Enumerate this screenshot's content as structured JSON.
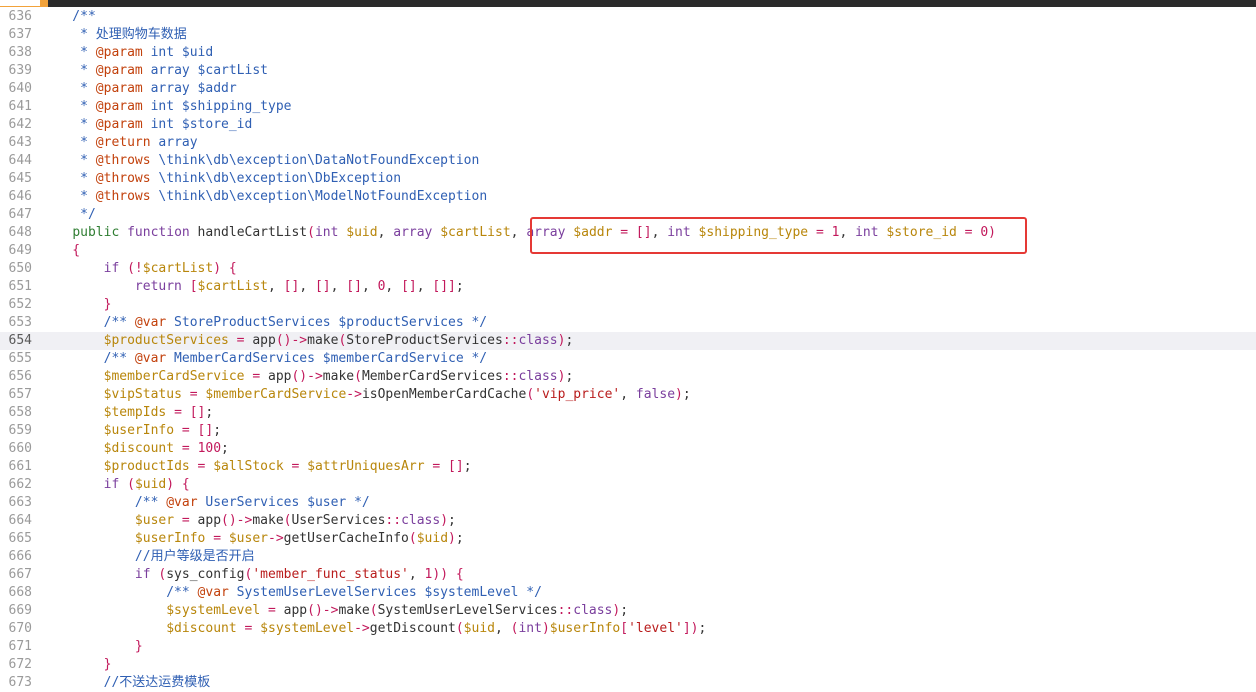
{
  "editor": {
    "active_line": "654",
    "lines": [
      {
        "num": "636",
        "tokens": [
          [
            "cmt",
            "    /**"
          ]
        ]
      },
      {
        "num": "637",
        "tokens": [
          [
            "cmt",
            "     * 处理购物车数据"
          ]
        ]
      },
      {
        "num": "638",
        "tokens": [
          [
            "cmt",
            "     * "
          ],
          [
            "tag",
            "@param"
          ],
          [
            "cmt",
            " int $uid"
          ]
        ]
      },
      {
        "num": "639",
        "tokens": [
          [
            "cmt",
            "     * "
          ],
          [
            "tag",
            "@param"
          ],
          [
            "cmt",
            " array $cartList"
          ]
        ]
      },
      {
        "num": "640",
        "tokens": [
          [
            "cmt",
            "     * "
          ],
          [
            "tag",
            "@param"
          ],
          [
            "cmt",
            " array $addr"
          ]
        ]
      },
      {
        "num": "641",
        "tokens": [
          [
            "cmt",
            "     * "
          ],
          [
            "tag",
            "@param"
          ],
          [
            "cmt",
            " int $shipping_type"
          ]
        ]
      },
      {
        "num": "642",
        "tokens": [
          [
            "cmt",
            "     * "
          ],
          [
            "tag",
            "@param"
          ],
          [
            "cmt",
            " int $store_id"
          ]
        ]
      },
      {
        "num": "643",
        "tokens": [
          [
            "cmt",
            "     * "
          ],
          [
            "tag",
            "@return"
          ],
          [
            "cmt",
            " array"
          ]
        ]
      },
      {
        "num": "644",
        "tokens": [
          [
            "cmt",
            "     * "
          ],
          [
            "tag",
            "@throws"
          ],
          [
            "cmt",
            " \\think\\db\\exception\\DataNotFoundException"
          ]
        ]
      },
      {
        "num": "645",
        "tokens": [
          [
            "cmt",
            "     * "
          ],
          [
            "tag",
            "@throws"
          ],
          [
            "cmt",
            " \\think\\db\\exception\\DbException"
          ]
        ]
      },
      {
        "num": "646",
        "tokens": [
          [
            "cmt",
            "     * "
          ],
          [
            "tag",
            "@throws"
          ],
          [
            "cmt",
            " \\think\\db\\exception\\ModelNotFoundException"
          ]
        ]
      },
      {
        "num": "647",
        "tokens": [
          [
            "cmt",
            "     */"
          ]
        ]
      },
      {
        "num": "648",
        "tokens": [
          [
            "txt",
            "    "
          ],
          [
            "pub",
            "public"
          ],
          [
            "txt",
            " "
          ],
          [
            "kw",
            "function"
          ],
          [
            "fn",
            " handleCartList"
          ],
          [
            "op",
            "("
          ],
          [
            "kw",
            "int"
          ],
          [
            "txt",
            " "
          ],
          [
            "var",
            "$uid"
          ],
          [
            "txt",
            ", "
          ],
          [
            "kw",
            "array"
          ],
          [
            "txt",
            " "
          ],
          [
            "var",
            "$cartList"
          ],
          [
            "txt",
            ", "
          ],
          [
            "kw",
            "array"
          ],
          [
            "txt",
            " "
          ],
          [
            "var",
            "$addr"
          ],
          [
            "op",
            " = []"
          ],
          [
            "txt",
            ", "
          ],
          [
            "kw",
            "int"
          ],
          [
            "txt",
            " "
          ],
          [
            "var",
            "$shipping_type"
          ],
          [
            "op",
            " = "
          ],
          [
            "num",
            "1"
          ],
          [
            "txt",
            ", "
          ],
          [
            "kw",
            "int"
          ],
          [
            "txt",
            " "
          ],
          [
            "var",
            "$store_id"
          ],
          [
            "op",
            " = "
          ],
          [
            "num",
            "0"
          ],
          [
            "op",
            ")"
          ]
        ]
      },
      {
        "num": "649",
        "tokens": [
          [
            "op",
            "    {"
          ]
        ]
      },
      {
        "num": "650",
        "tokens": [
          [
            "txt",
            "        "
          ],
          [
            "kw",
            "if"
          ],
          [
            "txt",
            " "
          ],
          [
            "op",
            "(!"
          ],
          [
            "var",
            "$cartList"
          ],
          [
            "op",
            ") {"
          ]
        ]
      },
      {
        "num": "651",
        "tokens": [
          [
            "txt",
            "            "
          ],
          [
            "kw",
            "return"
          ],
          [
            "txt",
            " "
          ],
          [
            "op",
            "["
          ],
          [
            "var",
            "$cartList"
          ],
          [
            "txt",
            ", "
          ],
          [
            "op",
            "[]"
          ],
          [
            "txt",
            ", "
          ],
          [
            "op",
            "[]"
          ],
          [
            "txt",
            ", "
          ],
          [
            "op",
            "[]"
          ],
          [
            "txt",
            ", "
          ],
          [
            "num",
            "0"
          ],
          [
            "txt",
            ", "
          ],
          [
            "op",
            "[]"
          ],
          [
            "txt",
            ", "
          ],
          [
            "op",
            "[]]"
          ],
          [
            "txt",
            ";"
          ]
        ]
      },
      {
        "num": "652",
        "tokens": [
          [
            "op",
            "        }"
          ]
        ]
      },
      {
        "num": "653",
        "tokens": [
          [
            "cmt",
            "        /** "
          ],
          [
            "tag",
            "@var"
          ],
          [
            "cmt",
            " StoreProductServices $productServices */"
          ]
        ]
      },
      {
        "num": "654",
        "tokens": [
          [
            "txt",
            "        "
          ],
          [
            "var",
            "$productServices"
          ],
          [
            "op",
            " = "
          ],
          [
            "fn",
            "app"
          ],
          [
            "op",
            "()->"
          ],
          [
            "fn",
            "make"
          ],
          [
            "op",
            "("
          ],
          [
            "txt",
            "StoreProductServices"
          ],
          [
            "op",
            "::"
          ],
          [
            "kw",
            "class"
          ],
          [
            "op",
            ")"
          ],
          [
            "txt",
            ";"
          ]
        ]
      },
      {
        "num": "655",
        "tokens": [
          [
            "cmt",
            "        /** "
          ],
          [
            "tag",
            "@var"
          ],
          [
            "cmt",
            " MemberCardServices $memberCardService */"
          ]
        ]
      },
      {
        "num": "656",
        "tokens": [
          [
            "txt",
            "        "
          ],
          [
            "var",
            "$memberCardService"
          ],
          [
            "op",
            " = "
          ],
          [
            "fn",
            "app"
          ],
          [
            "op",
            "()->"
          ],
          [
            "fn",
            "make"
          ],
          [
            "op",
            "("
          ],
          [
            "txt",
            "MemberCardServices"
          ],
          [
            "op",
            "::"
          ],
          [
            "kw",
            "class"
          ],
          [
            "op",
            ")"
          ],
          [
            "txt",
            ";"
          ]
        ]
      },
      {
        "num": "657",
        "tokens": [
          [
            "txt",
            "        "
          ],
          [
            "var",
            "$vipStatus"
          ],
          [
            "op",
            " = "
          ],
          [
            "var",
            "$memberCardService"
          ],
          [
            "op",
            "->"
          ],
          [
            "fn",
            "isOpenMemberCardCache"
          ],
          [
            "op",
            "("
          ],
          [
            "str",
            "'vip_price'"
          ],
          [
            "txt",
            ", "
          ],
          [
            "kw",
            "false"
          ],
          [
            "op",
            ")"
          ],
          [
            "txt",
            ";"
          ]
        ]
      },
      {
        "num": "658",
        "tokens": [
          [
            "txt",
            "        "
          ],
          [
            "var",
            "$tempIds"
          ],
          [
            "op",
            " = []"
          ],
          [
            "txt",
            ";"
          ]
        ]
      },
      {
        "num": "659",
        "tokens": [
          [
            "txt",
            "        "
          ],
          [
            "var",
            "$userInfo"
          ],
          [
            "op",
            " = []"
          ],
          [
            "txt",
            ";"
          ]
        ]
      },
      {
        "num": "660",
        "tokens": [
          [
            "txt",
            "        "
          ],
          [
            "var",
            "$discount"
          ],
          [
            "op",
            " = "
          ],
          [
            "num",
            "100"
          ],
          [
            "txt",
            ";"
          ]
        ]
      },
      {
        "num": "661",
        "tokens": [
          [
            "txt",
            "        "
          ],
          [
            "var",
            "$productIds"
          ],
          [
            "op",
            " = "
          ],
          [
            "var",
            "$allStock"
          ],
          [
            "op",
            " = "
          ],
          [
            "var",
            "$attrUniquesArr"
          ],
          [
            "op",
            " = []"
          ],
          [
            "txt",
            ";"
          ]
        ]
      },
      {
        "num": "662",
        "tokens": [
          [
            "txt",
            "        "
          ],
          [
            "kw",
            "if"
          ],
          [
            "txt",
            " "
          ],
          [
            "op",
            "("
          ],
          [
            "var",
            "$uid"
          ],
          [
            "op",
            ") {"
          ]
        ]
      },
      {
        "num": "663",
        "tokens": [
          [
            "cmt",
            "            /** "
          ],
          [
            "tag",
            "@var"
          ],
          [
            "cmt",
            " UserServices $user */"
          ]
        ]
      },
      {
        "num": "664",
        "tokens": [
          [
            "txt",
            "            "
          ],
          [
            "var",
            "$user"
          ],
          [
            "op",
            " = "
          ],
          [
            "fn",
            "app"
          ],
          [
            "op",
            "()->"
          ],
          [
            "fn",
            "make"
          ],
          [
            "op",
            "("
          ],
          [
            "txt",
            "UserServices"
          ],
          [
            "op",
            "::"
          ],
          [
            "kw",
            "class"
          ],
          [
            "op",
            ")"
          ],
          [
            "txt",
            ";"
          ]
        ]
      },
      {
        "num": "665",
        "tokens": [
          [
            "txt",
            "            "
          ],
          [
            "var",
            "$userInfo"
          ],
          [
            "op",
            " = "
          ],
          [
            "var",
            "$user"
          ],
          [
            "op",
            "->"
          ],
          [
            "fn",
            "getUserCacheInfo"
          ],
          [
            "op",
            "("
          ],
          [
            "var",
            "$uid"
          ],
          [
            "op",
            ")"
          ],
          [
            "txt",
            ";"
          ]
        ]
      },
      {
        "num": "666",
        "tokens": [
          [
            "cmt",
            "            //用户等级是否开启"
          ]
        ]
      },
      {
        "num": "667",
        "tokens": [
          [
            "txt",
            "            "
          ],
          [
            "kw",
            "if"
          ],
          [
            "txt",
            " "
          ],
          [
            "op",
            "("
          ],
          [
            "fn",
            "sys_config"
          ],
          [
            "op",
            "("
          ],
          [
            "str",
            "'member_func_status'"
          ],
          [
            "txt",
            ", "
          ],
          [
            "num",
            "1"
          ],
          [
            "op",
            ")) {"
          ]
        ]
      },
      {
        "num": "668",
        "tokens": [
          [
            "cmt",
            "                /** "
          ],
          [
            "tag",
            "@var"
          ],
          [
            "cmt",
            " SystemUserLevelServices $systemLevel */"
          ]
        ]
      },
      {
        "num": "669",
        "tokens": [
          [
            "txt",
            "                "
          ],
          [
            "var",
            "$systemLevel"
          ],
          [
            "op",
            " = "
          ],
          [
            "fn",
            "app"
          ],
          [
            "op",
            "()->"
          ],
          [
            "fn",
            "make"
          ],
          [
            "op",
            "("
          ],
          [
            "txt",
            "SystemUserLevelServices"
          ],
          [
            "op",
            "::"
          ],
          [
            "kw",
            "class"
          ],
          [
            "op",
            ")"
          ],
          [
            "txt",
            ";"
          ]
        ]
      },
      {
        "num": "670",
        "tokens": [
          [
            "txt",
            "                "
          ],
          [
            "var",
            "$discount"
          ],
          [
            "op",
            " = "
          ],
          [
            "var",
            "$systemLevel"
          ],
          [
            "op",
            "->"
          ],
          [
            "fn",
            "getDiscount"
          ],
          [
            "op",
            "("
          ],
          [
            "var",
            "$uid"
          ],
          [
            "txt",
            ", "
          ],
          [
            "op",
            "("
          ],
          [
            "kw",
            "int"
          ],
          [
            "op",
            ")"
          ],
          [
            "var",
            "$userInfo"
          ],
          [
            "op",
            "["
          ],
          [
            "str",
            "'level'"
          ],
          [
            "op",
            "])"
          ],
          [
            "txt",
            ";"
          ]
        ]
      },
      {
        "num": "671",
        "tokens": [
          [
            "op",
            "            }"
          ]
        ]
      },
      {
        "num": "672",
        "tokens": [
          [
            "op",
            "        }"
          ]
        ]
      },
      {
        "num": "673",
        "tokens": [
          [
            "cmt",
            "        //不送达运费模板"
          ]
        ]
      }
    ]
  },
  "colors": {
    "highlight_border": "#e53935",
    "active_line_bg": "#f0f0f4"
  }
}
